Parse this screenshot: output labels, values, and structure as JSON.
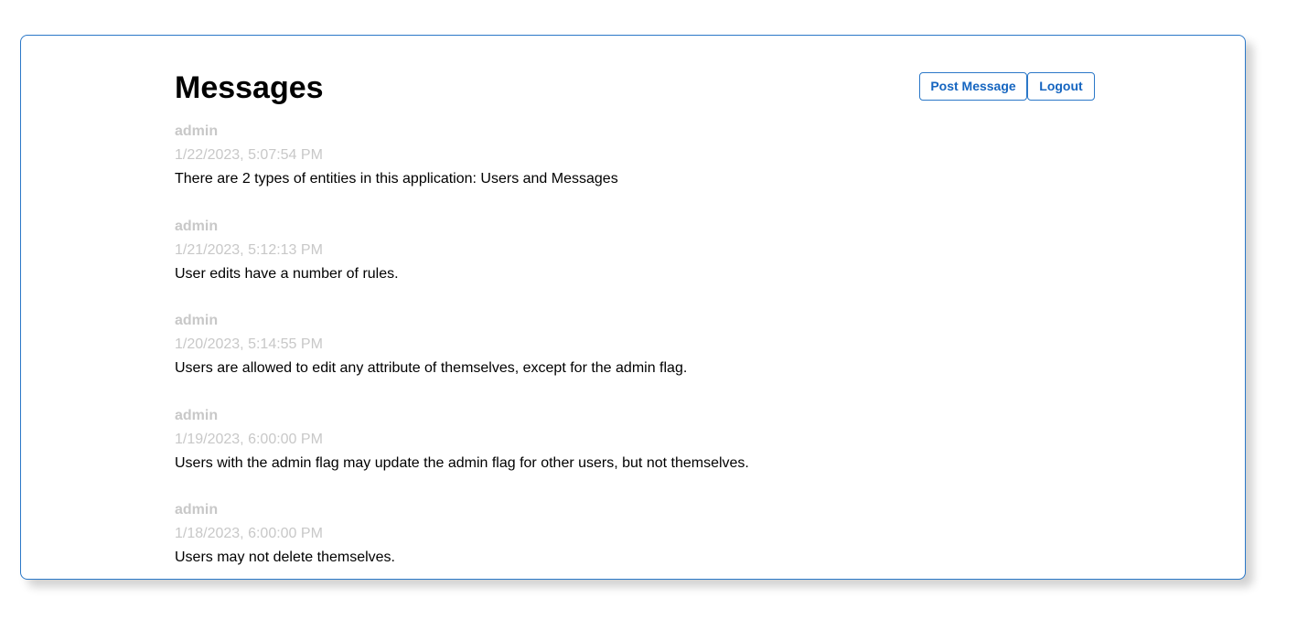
{
  "header": {
    "title": "Messages",
    "post_message_label": "Post Message",
    "logout_label": "Logout"
  },
  "colors": {
    "accent": "#2b78c8",
    "button_text": "#1565c0",
    "muted_text": "#c8c8c8",
    "body_text": "#000000"
  },
  "messages": [
    {
      "author": "admin",
      "timestamp": "1/22/2023, 5:07:54 PM",
      "body": "There are 2 types of entities in this application: Users and Messages"
    },
    {
      "author": "admin",
      "timestamp": "1/21/2023, 5:12:13 PM",
      "body": "User edits have a number of rules."
    },
    {
      "author": "admin",
      "timestamp": "1/20/2023, 5:14:55 PM",
      "body": "Users are allowed to edit any attribute of themselves, except for the admin flag."
    },
    {
      "author": "admin",
      "timestamp": "1/19/2023, 6:00:00 PM",
      "body": "Users with the admin flag may update the admin flag for other users, but not themselves."
    },
    {
      "author": "admin",
      "timestamp": "1/18/2023, 6:00:00 PM",
      "body": "Users may not delete themselves."
    }
  ]
}
